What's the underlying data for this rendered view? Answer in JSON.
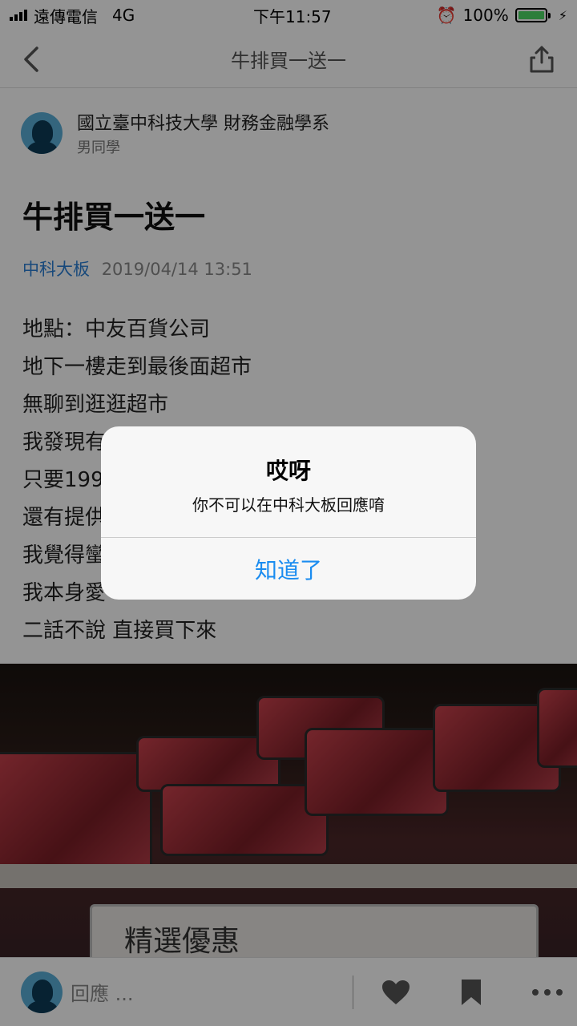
{
  "status_bar": {
    "carrier": "遠傳電信",
    "network": "4G",
    "time": "下午11:57",
    "battery": "100%"
  },
  "nav": {
    "title": "牛排買一送一"
  },
  "author": {
    "school": "國立臺中科技大學 財務金融學系",
    "gender": "男同學"
  },
  "post": {
    "title": "牛排買一送一",
    "board": "中科大板",
    "timestamp": "2019/04/14 13:51",
    "lines": [
      "地點：中友百貨公司",
      "地下一樓走到最後面超市",
      "無聊到逛逛超市",
      "我發現有",
      "只要199",
      "還有提供",
      "我覺得蠻",
      "我本身愛",
      "二話不說 直接買下來"
    ]
  },
  "photo": {
    "sign_text": "精選優惠"
  },
  "bottom_bar": {
    "reply_placeholder": "回應 ..."
  },
  "alert": {
    "title": "哎呀",
    "message": "你不可以在中科大板回應唷",
    "button_label": "知道了"
  },
  "colors": {
    "accent": "#1a8cf0",
    "board_link": "#2a7fd4",
    "avatar": "#5aaed8",
    "battery": "#4cd964"
  }
}
